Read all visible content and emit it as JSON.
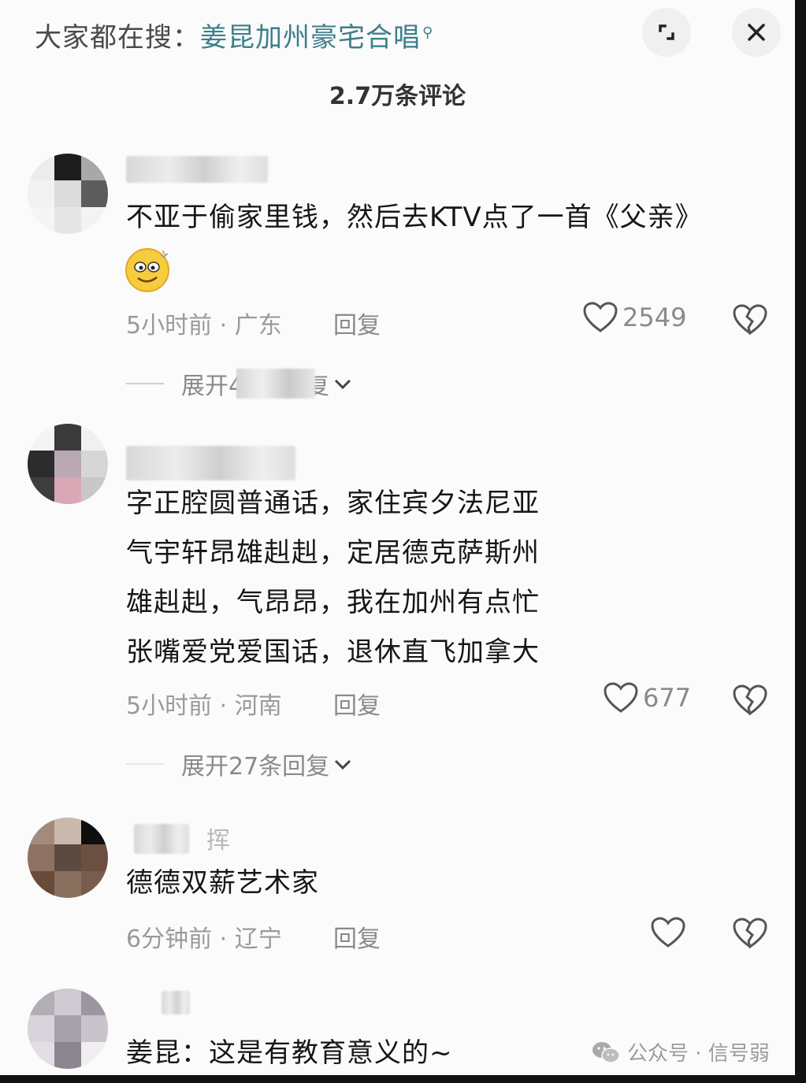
{
  "header": {
    "search_prefix": "大家都在搜：",
    "search_term": "姜昆加州豪宅合唱"
  },
  "comment_count": "2.7万条评论",
  "comments": [
    {
      "text_lines": [
        "不亚于偷家里钱，然后去KTV点了一首《父亲》"
      ],
      "time": "5小时前",
      "location": "广东",
      "reply": "回复",
      "likes": "2549",
      "expand": "展开40条回复"
    },
    {
      "text_lines": [
        "字正腔圆普通话，家住宾夕法尼亚",
        "气宇轩昂雄赳赳，定居德克萨斯州",
        "雄赳赳，气昂昂，我在加州有点忙",
        "张嘴爱党爱国话，退休直飞加拿大"
      ],
      "time": "5小时前",
      "location": "河南",
      "reply": "回复",
      "likes": "677",
      "expand": "展开27条回复"
    },
    {
      "username_fragment": "挥",
      "text_lines": [
        "德德双薪艺术家"
      ],
      "time": "6分钟前",
      "location": "辽宁",
      "reply": "回复",
      "likes": ""
    },
    {
      "text_lines": [
        "姜昆：这是有教育意义的~"
      ]
    }
  ],
  "watermark": {
    "text": "公众号 · 信号弱"
  },
  "colors": {
    "accent": "#3d7f8a",
    "meta": "#9a9a9a"
  }
}
